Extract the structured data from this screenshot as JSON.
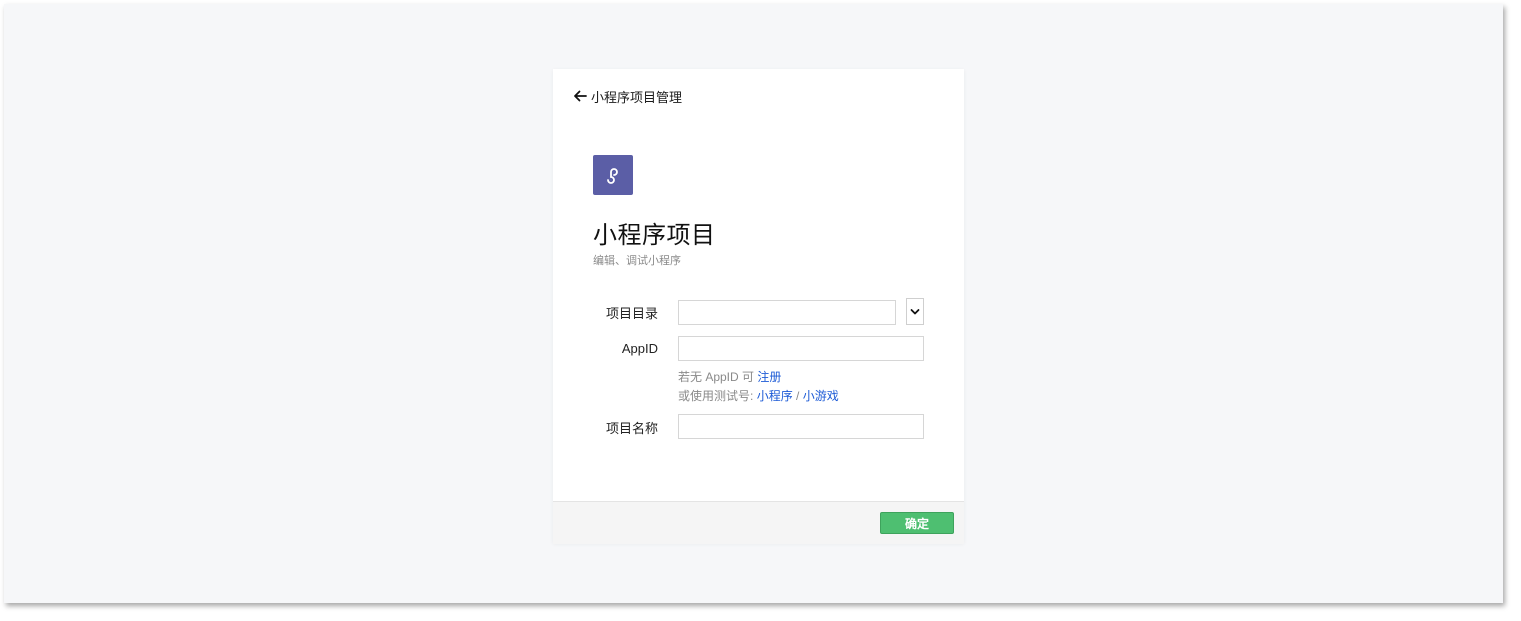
{
  "back": {
    "label": "小程序项目管理"
  },
  "header": {
    "title": "小程序项目",
    "subtitle": "编辑、调试小程序"
  },
  "form": {
    "dir_label": "项目目录",
    "dir_value": "",
    "appid_label": "AppID",
    "appid_value": "",
    "hint1_prefix": "若无 AppID 可",
    "hint1_link": "注册",
    "hint2_prefix": "或使用测试号:",
    "hint2_link1": "小程序",
    "hint2_sep": "/",
    "hint2_link2": "小游戏",
    "name_label": "项目名称",
    "name_value": ""
  },
  "footer": {
    "confirm_label": "确定"
  },
  "icons": {
    "back": "arrow-left-icon",
    "logo": "miniprogram-logo-icon",
    "dropdown": "chevron-down-icon"
  },
  "colors": {
    "logo_bg": "#5b5ea6",
    "link": "#1d5bd6",
    "confirm_bg": "#4ebf71",
    "window_bg": "#f6f7f9"
  }
}
